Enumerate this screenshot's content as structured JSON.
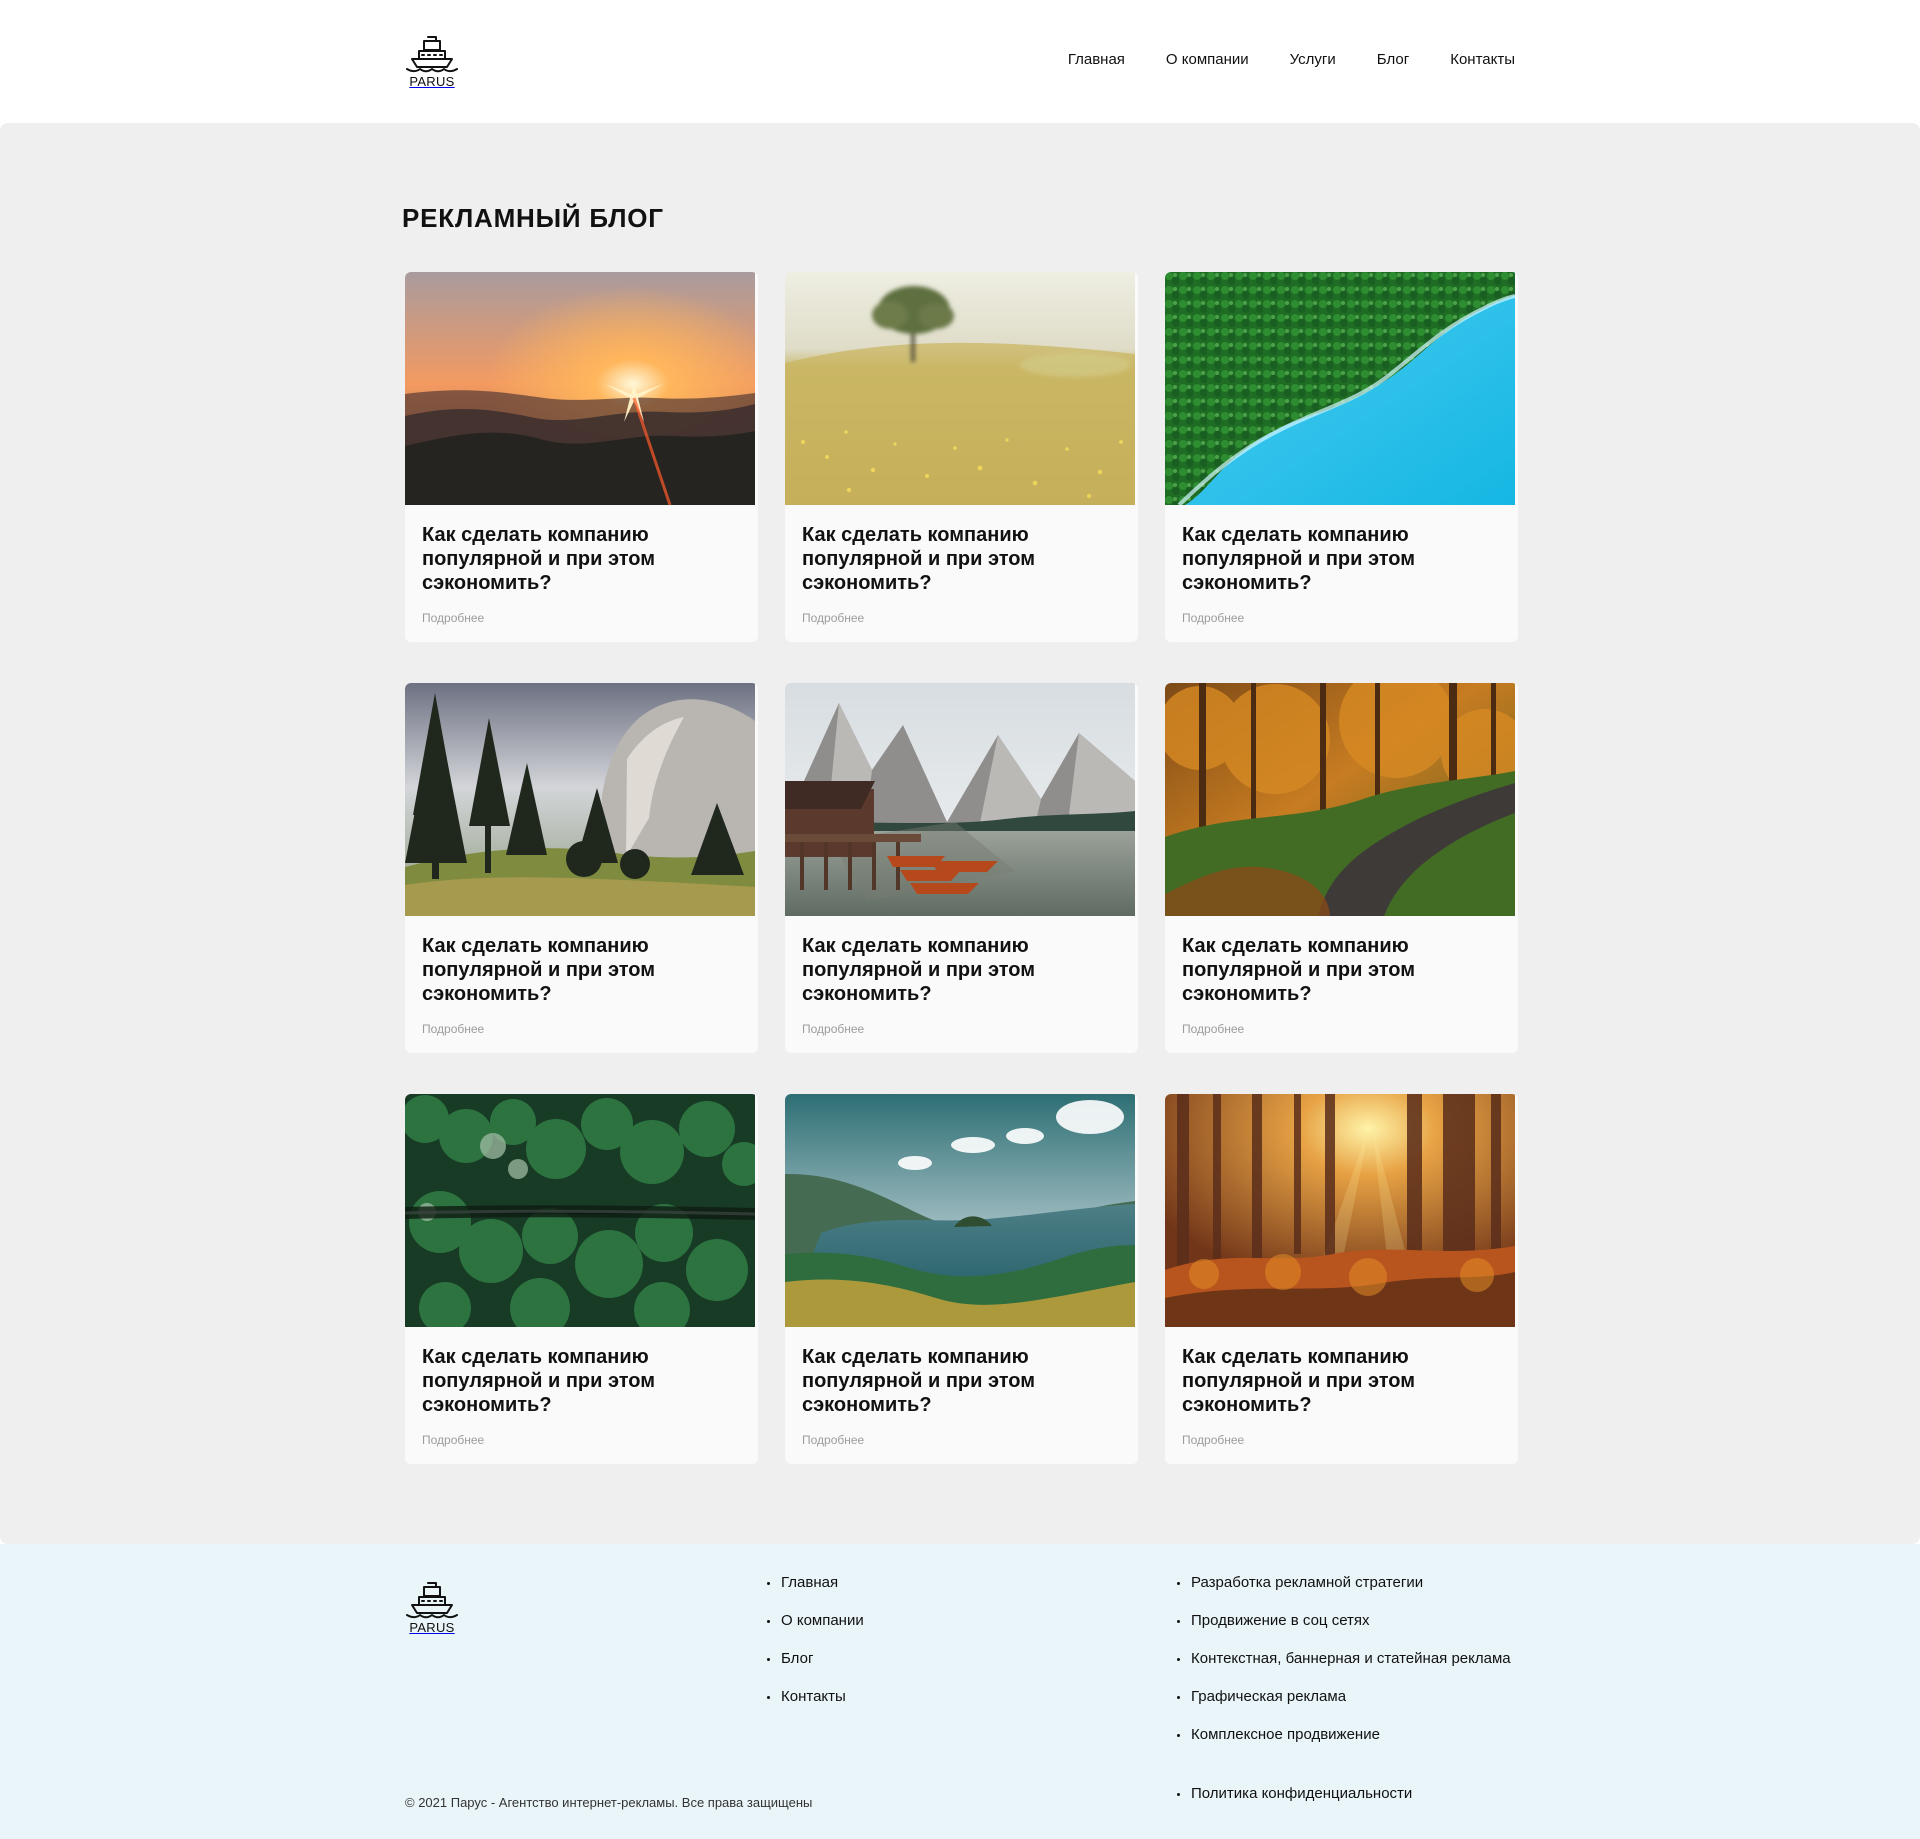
{
  "header": {
    "logo_text": "PARUS",
    "nav": [
      "Главная",
      "О компании",
      "Услуги",
      "Блог",
      "Контакты"
    ]
  },
  "main": {
    "title": "РЕКЛАМНЫЙ БЛОГ",
    "cards": [
      {
        "title": "Как сделать компанию популярной и при этом сэкономить?",
        "link": "Подробнее",
        "image": "mountain-sunset-image"
      },
      {
        "title": "Как сделать компанию популярной и при этом сэкономить?",
        "link": "Подробнее",
        "image": "tree-field-image"
      },
      {
        "title": "Как сделать компанию популярной и при этом сэкономить?",
        "link": "Подробнее",
        "image": "forest-lake-aerial-image"
      },
      {
        "title": "Как сделать компанию популярной и при этом сэкономить?",
        "link": "Подробнее",
        "image": "pine-cliff-image"
      },
      {
        "title": "Как сделать компанию популярной и при этом сэкономить?",
        "link": "Подробнее",
        "image": "alpine-lake-boats-image"
      },
      {
        "title": "Как сделать компанию популярной и при этом сэкономить?",
        "link": "Подробнее",
        "image": "autumn-forest-road-image"
      },
      {
        "title": "Как сделать компанию популярной и при этом сэкономить?",
        "link": "Подробнее",
        "image": "pine-forest-aerial-image"
      },
      {
        "title": "Как сделать компанию популярной и при этом сэкономить?",
        "link": "Подробнее",
        "image": "lake-island-image"
      },
      {
        "title": "Как сделать компанию популярной и при этом сэкономить?",
        "link": "Подробнее",
        "image": "sunlit-forest-image"
      }
    ]
  },
  "footer": {
    "logo_text": "PARUS",
    "menu": [
      "Главная",
      "О компании",
      "Блог",
      "Контакты"
    ],
    "services": [
      "Разработка рекламной стратегии",
      "Продвижение в соц сетях",
      "Контекстная, баннерная и статейная реклама",
      "Графическая реклама",
      "Комплексное продвижение"
    ],
    "privacy": "Политика конфиденциальности",
    "copyright": "© 2021 Парус - Агентство интернет-рекламы. Все права защищены"
  }
}
